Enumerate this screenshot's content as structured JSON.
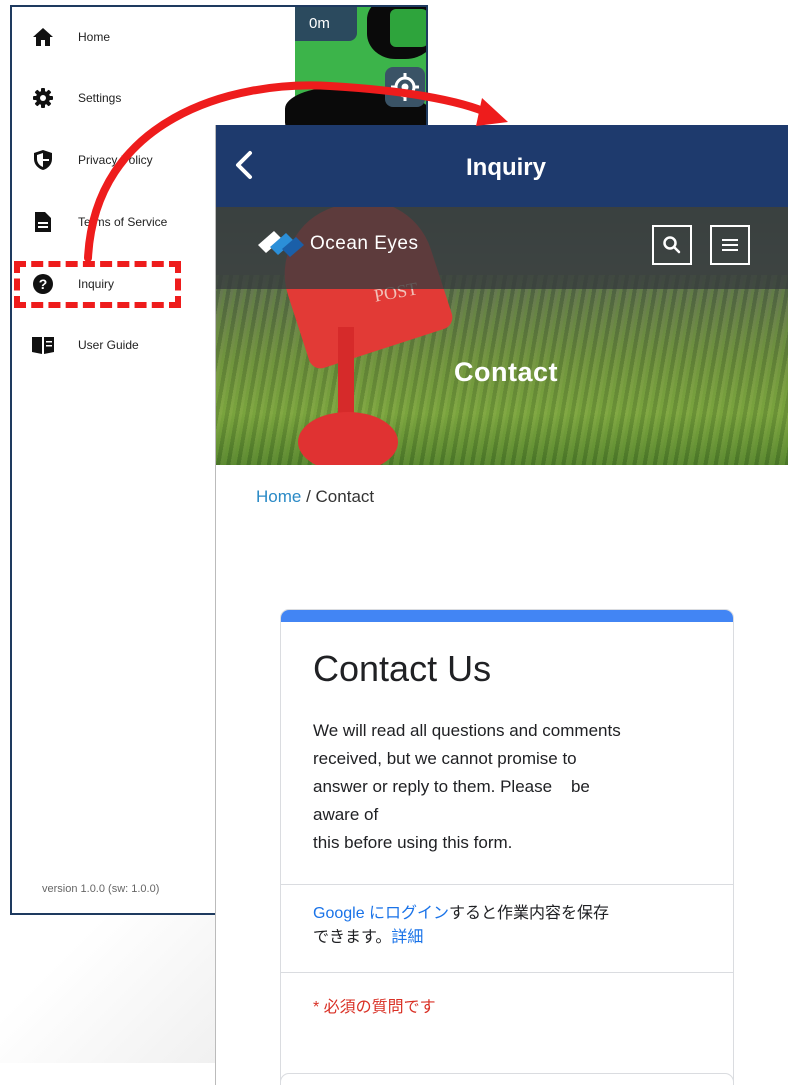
{
  "left_screen": {
    "map": {
      "distance": "0m"
    },
    "drawer": {
      "items": [
        {
          "label": "Home",
          "icon": "home-icon"
        },
        {
          "label": "Settings",
          "icon": "gear-icon"
        },
        {
          "label": "Privacy Policy",
          "icon": "shield-icon"
        },
        {
          "label": "Terms of Service",
          "icon": "document-icon"
        },
        {
          "label": "Inquiry",
          "icon": "question-icon"
        },
        {
          "label": "User Guide",
          "icon": "book-icon"
        }
      ],
      "version": "version 1.0.0 (sw:  1.0.0)"
    }
  },
  "right_screen": {
    "appbar": {
      "title": "Inquiry"
    },
    "hero": {
      "logo_text": "Ocean Eyes",
      "mailbox_text": "POST",
      "title": "Contact"
    },
    "breadcrumb": {
      "home": "Home",
      "separator": " / ",
      "current": "Contact"
    },
    "form": {
      "title": "Contact Us",
      "description_lines": [
        "We will read all questions and comments",
        "received, but we cannot promise to",
        "answer or reply to them. Please    be",
        "aware of",
        "this before using this form."
      ],
      "login_link": "Google にログイン",
      "login_text": "すると作業内容を保存",
      "login_text2": "できます。",
      "details_link": "詳細",
      "required_note": "* 必須の質問です"
    }
  },
  "colors": {
    "appbar": "#1e3a6d",
    "accent_red": "#ee1c1c",
    "form_accent": "#4285f4",
    "link_blue": "#1a73e8",
    "required_red": "#d93025",
    "breadcrumb_link": "#2a8ac6"
  }
}
